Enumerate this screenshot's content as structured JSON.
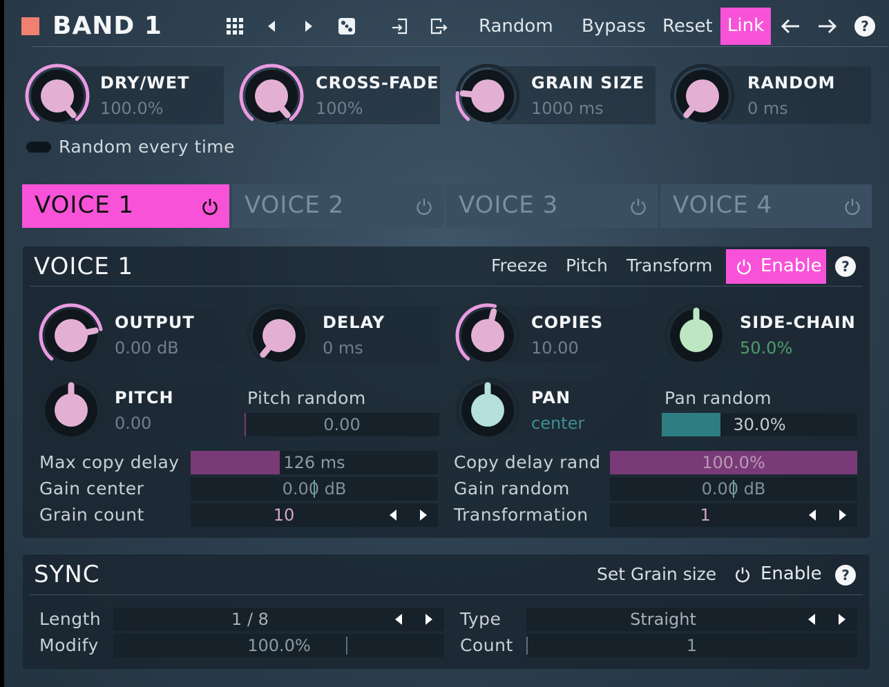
{
  "header": {
    "title": "BAND 1",
    "buttons": {
      "random": "Random",
      "bypass": "Bypass",
      "reset": "Reset",
      "link": "Link"
    },
    "help": "?"
  },
  "top_knobs": [
    {
      "label": "DRY/WET",
      "value": "100.0%",
      "level": 1.0
    },
    {
      "label": "CROSS-FADE",
      "value": "100%",
      "level": 1.0
    },
    {
      "label": "GRAIN SIZE",
      "value": "1000 ms",
      "level": 0.2
    },
    {
      "label": "RANDOM",
      "value": "0 ms",
      "level": 0.0
    }
  ],
  "random_every_time": "Random every time",
  "tabs": [
    {
      "label": "VOICE 1",
      "active": true
    },
    {
      "label": "VOICE 2",
      "active": false
    },
    {
      "label": "VOICE 3",
      "active": false
    },
    {
      "label": "VOICE 4",
      "active": false
    }
  ],
  "voice": {
    "title": "VOICE 1",
    "links": {
      "freeze": "Freeze",
      "pitch": "Pitch",
      "transform": "Transform",
      "enable": "Enable"
    },
    "help": "?",
    "knobs": {
      "output": {
        "label": "OUTPUT",
        "value": "0.00 dB",
        "level": 0.78
      },
      "delay": {
        "label": "DELAY",
        "value": "0 ms",
        "level": 0.0
      },
      "copies": {
        "label": "COPIES",
        "value": "10.00",
        "level": 0.55
      },
      "sidechain": {
        "label": "SIDE-CHAIN",
        "value": "50.0%",
        "level": 0.5
      },
      "pitch": {
        "label": "PITCH",
        "value": "0.00",
        "level": 0.5
      },
      "pan": {
        "label": "PAN",
        "value": "center",
        "level": 0.5
      }
    },
    "pitch_random": {
      "label": "Pitch random",
      "value": "0.00",
      "level": 0.0
    },
    "pan_random": {
      "label": "Pan random",
      "value": "30.0%",
      "level": 0.3
    },
    "rows": {
      "max_copy_delay": {
        "label": "Max copy delay",
        "value": "126 ms",
        "level": 0.36
      },
      "gain_center": {
        "label": "Gain center",
        "value": "0.00 dB"
      },
      "grain_count": {
        "label": "Grain count",
        "value": "10"
      },
      "copy_delay_rand": {
        "label": "Copy delay rand",
        "value": "100.0%",
        "level": 1.0
      },
      "gain_random": {
        "label": "Gain random",
        "value": "0.00 dB"
      },
      "transformation": {
        "label": "Transformation",
        "value": "1"
      }
    }
  },
  "sync": {
    "title": "SYNC",
    "set_grain_size": "Set Grain size",
    "enable": "Enable",
    "help": "?",
    "length": {
      "label": "Length",
      "value": "1 / 8"
    },
    "modify": {
      "label": "Modify",
      "value": "100.0%"
    },
    "type": {
      "label": "Type",
      "value": "Straight"
    },
    "count": {
      "label": "Count",
      "value": "1"
    }
  },
  "colors": {
    "accent": "#f853d8",
    "header_square": "#f08070",
    "knob_pink": "#e3b0d4",
    "knob_teal": "#b5e0dc",
    "knob_green": "#bde6c3",
    "arc_pink": "#e99be0",
    "arc_green": "#9fe6a9",
    "bar_purple": "#7a3a78",
    "bar_teal": "#2e7d80"
  }
}
